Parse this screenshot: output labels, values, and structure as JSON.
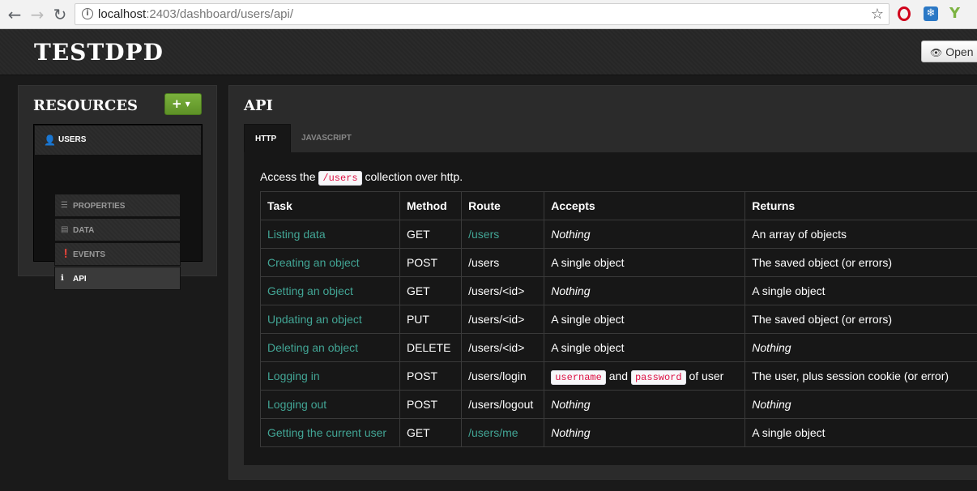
{
  "browser": {
    "url_host": "localhost",
    "url_path": ":2403/dashboard/users/api/"
  },
  "header": {
    "brand": "TESTDPD",
    "open_label": "Open"
  },
  "sidebar": {
    "title": "RESOURCES",
    "add_label": "+",
    "resource": "USERS",
    "items": [
      {
        "label": "PROPERTIES",
        "icon": "list-icon"
      },
      {
        "label": "DATA",
        "icon": "table-icon"
      },
      {
        "label": "EVENTS",
        "icon": "exclamation-icon"
      },
      {
        "label": "API",
        "icon": "info-icon",
        "active": true
      }
    ]
  },
  "main": {
    "title": "API",
    "tabs": [
      {
        "label": "HTTP",
        "active": true
      },
      {
        "label": "JAVASCRIPT",
        "active": false
      }
    ],
    "intro_before": "Access the",
    "intro_code": "/users",
    "intro_after": "collection over http.",
    "table": {
      "headers": [
        "Task",
        "Method",
        "Route",
        "Accepts",
        "Returns"
      ],
      "rows": [
        {
          "task": "Listing data",
          "method": "GET",
          "route": "/users",
          "accepts": "Nothing",
          "returns": "An array of objects"
        },
        {
          "task": "Creating an object",
          "method": "POST",
          "route": "/users",
          "accepts": "A single object",
          "returns": "The saved object (or errors)"
        },
        {
          "task": "Getting an object",
          "method": "GET",
          "route": "/users/<id>",
          "accepts": "Nothing",
          "returns": "A single object"
        },
        {
          "task": "Updating an object",
          "method": "PUT",
          "route": "/users/<id>",
          "accepts": "A single object",
          "returns": "The saved object (or errors)"
        },
        {
          "task": "Deleting an object",
          "method": "DELETE",
          "route": "/users/<id>",
          "accepts": "A single object",
          "returns": "Nothing"
        },
        {
          "task": "Logging in",
          "method": "POST",
          "route": "/users/login",
          "accepts_code1": "username",
          "accepts_mid": "and",
          "accepts_code2": "password",
          "accepts_after": "of user",
          "returns": "The user, plus session cookie (or error)"
        },
        {
          "task": "Logging out",
          "method": "POST",
          "route": "/users/logout",
          "accepts": "Nothing",
          "returns": "Nothing"
        },
        {
          "task": "Getting the current user",
          "method": "GET",
          "route": "/users/me",
          "accepts": "Nothing",
          "returns": "A single object"
        }
      ]
    }
  },
  "colors": {
    "link": "#42a595",
    "add_button": "#6ea33a",
    "code_text": "#dd1144"
  }
}
